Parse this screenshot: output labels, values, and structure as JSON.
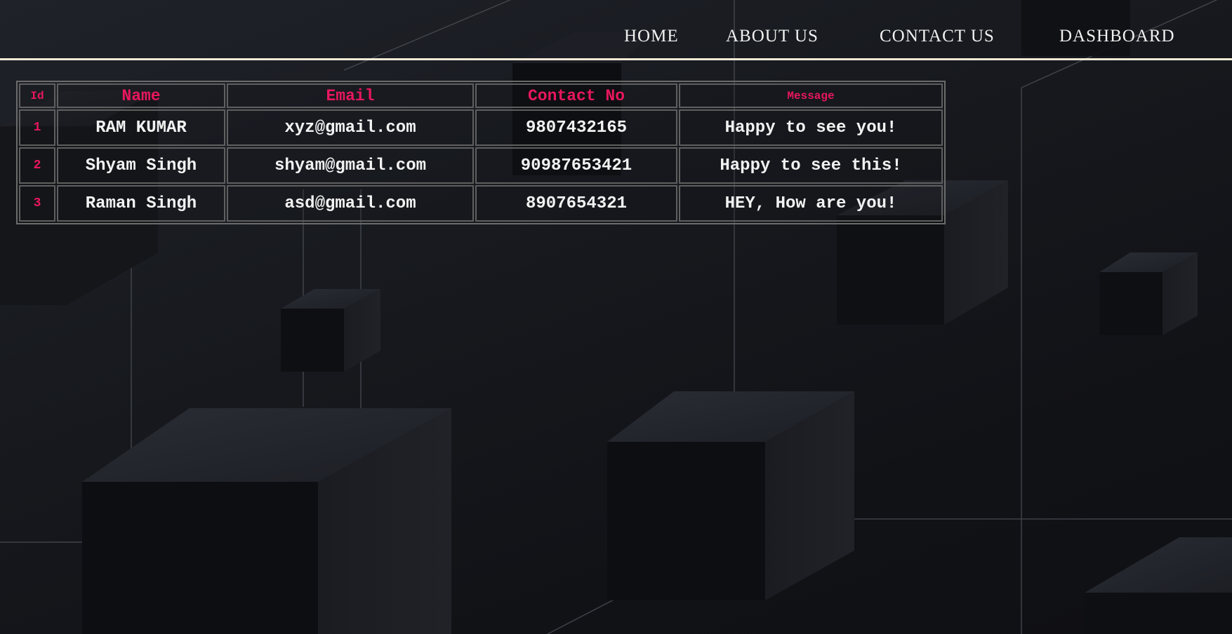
{
  "nav": {
    "home": "HOME",
    "about": "ABOUT US",
    "contact": "CONTACT US",
    "dashboard": "DASHBOARD"
  },
  "table": {
    "headers": {
      "id": "Id",
      "name": "Name",
      "email": "Email",
      "contact": "Contact No",
      "message": "Message"
    },
    "rows": [
      {
        "id": "1",
        "name": "RAM KUMAR",
        "email": "xyz@gmail.com",
        "contact": "9807432165",
        "message": "Happy to see you!"
      },
      {
        "id": "2",
        "name": "Shyam Singh",
        "email": "shyam@gmail.com",
        "contact": "90987653421",
        "message": "Happy to see this!"
      },
      {
        "id": "3",
        "name": "Raman Singh",
        "email": "asd@gmail.com",
        "contact": "8907654321",
        "message": "HEY, How are you!"
      }
    ]
  },
  "colors": {
    "accent": "#e8175d",
    "nav_underline": "#efe9d6",
    "background": "#16181d"
  }
}
